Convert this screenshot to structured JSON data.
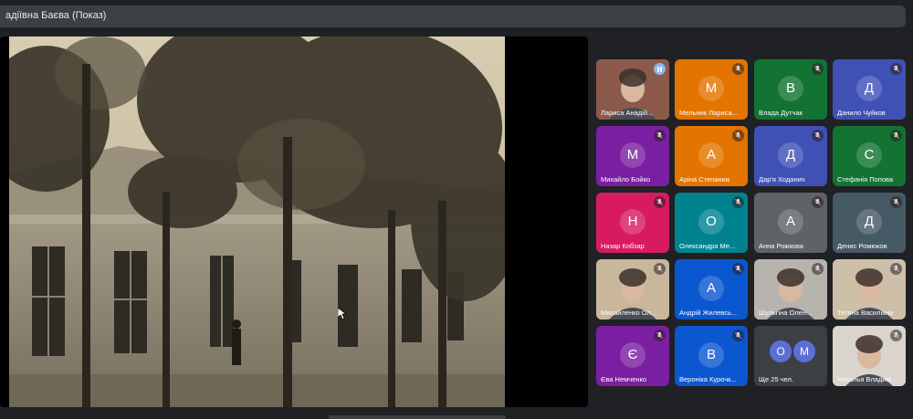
{
  "header": {
    "presenter_title": "адіївна Баєва (Показ)"
  },
  "participants": [
    {
      "name": "Лариса Анадій...",
      "initial": "",
      "color": "#8c5a4a",
      "video": true,
      "speaking": true
    },
    {
      "name": "Мельник Лариса...",
      "initial": "М",
      "color": "#e37400",
      "video": false,
      "speaking": false
    },
    {
      "name": "Влада Дутчак",
      "initial": "В",
      "color": "#137333",
      "video": false,
      "speaking": false
    },
    {
      "name": "Данило Чуйков",
      "initial": "Д",
      "color": "#3f51b5",
      "video": false,
      "speaking": false
    },
    {
      "name": "Михайло Бойко",
      "initial": "М",
      "color": "#7b1fa2",
      "video": false,
      "speaking": false
    },
    {
      "name": "Аріна Степанюк",
      "initial": "А",
      "color": "#e37400",
      "video": false,
      "speaking": false
    },
    {
      "name": "Дар'я Ходанич",
      "initial": "Д",
      "color": "#3f51b5",
      "video": false,
      "speaking": false
    },
    {
      "name": "Стефанія Попова",
      "initial": "С",
      "color": "#137333",
      "video": false,
      "speaking": false
    },
    {
      "name": "Назар Кобзар",
      "initial": "Н",
      "color": "#d81b60",
      "video": false,
      "speaking": false
    },
    {
      "name": "Олександра Ме...",
      "initial": "О",
      "color": "#00838f",
      "video": false,
      "speaking": false
    },
    {
      "name": "Анна Рожкова",
      "initial": "А",
      "color": "#5f6368",
      "video": false,
      "speaking": false
    },
    {
      "name": "Денис Ромюков",
      "initial": "Д",
      "color": "#455a64",
      "video": false,
      "speaking": false
    },
    {
      "name": "Михайленко Ол...",
      "initial": "",
      "color": "#c9b79c",
      "video": true,
      "speaking": false
    },
    {
      "name": "Андрій Жилевсь...",
      "initial": "А",
      "color": "#0b57d0",
      "video": false,
      "speaking": false
    },
    {
      "name": "Шульгіна Олен...",
      "initial": "",
      "color": "#b7b3ad",
      "video": true,
      "speaking": false
    },
    {
      "name": "Тетяна Василівна",
      "initial": "",
      "color": "#cdbfa8",
      "video": true,
      "speaking": false
    },
    {
      "name": "Єва Немченко",
      "initial": "Є",
      "color": "#7b1fa2",
      "video": false,
      "speaking": false
    },
    {
      "name": "Вероніка Курочк...",
      "initial": "В",
      "color": "#0b57d0",
      "video": false,
      "speaking": false
    },
    {
      "name": "Ще 25 чел.",
      "initial": "",
      "color": "#3c4043",
      "video": false,
      "speaking": false,
      "more": [
        "О",
        "М"
      ]
    },
    {
      "name": "Наталья Владим...",
      "initial": "",
      "color": "#d9d4cc",
      "video": true,
      "speaking": false
    }
  ]
}
